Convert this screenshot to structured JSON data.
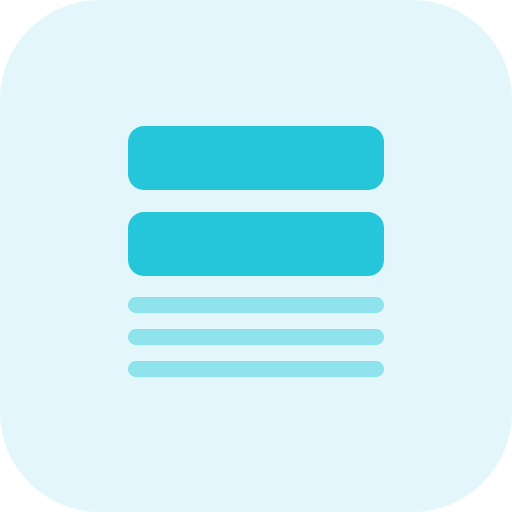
{
  "icon": {
    "name": "layout-list-icon",
    "colors": {
      "background": "#E2F6FB",
      "primary": "#26C6DA",
      "secondary": "#8DE2EC"
    }
  }
}
